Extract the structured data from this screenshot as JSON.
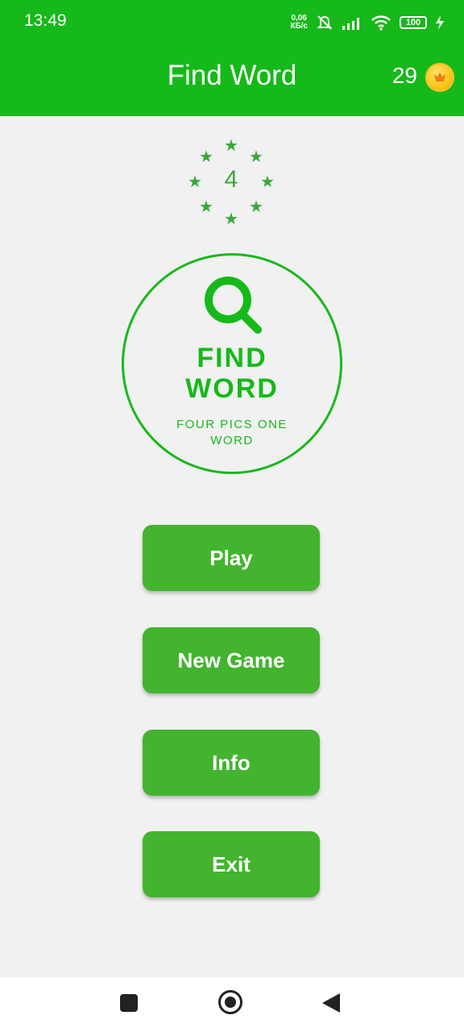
{
  "status_bar": {
    "time": "13:49",
    "net_speed_value": "0,06",
    "net_speed_unit": "КБ/с",
    "battery": "100",
    "icons": [
      "mute-bell-icon",
      "signal-icon",
      "wifi-icon",
      "battery-icon",
      "charging-bolt-icon"
    ]
  },
  "header": {
    "title": "Find Word",
    "coins": "29",
    "coin_icon": "coin-icon"
  },
  "level": {
    "number": "4",
    "stars_icon": "star-icon"
  },
  "logo": {
    "icon": "search-icon",
    "title_line1": "FIND",
    "title_line2": "WORD",
    "subtitle": "FOUR PICS ONE WORD"
  },
  "menu": {
    "play": "Play",
    "new_game": "New Game",
    "info": "Info",
    "exit": "Exit"
  },
  "nav": {
    "recents_icon": "recents-square-icon",
    "home_icon": "home-circle-icon",
    "back_icon": "back-triangle-icon"
  },
  "colors": {
    "primary": "#16b91a",
    "button": "#43b42e",
    "background": "#f1f1f1",
    "star": "#37a93a",
    "coin": "#f9c418"
  }
}
